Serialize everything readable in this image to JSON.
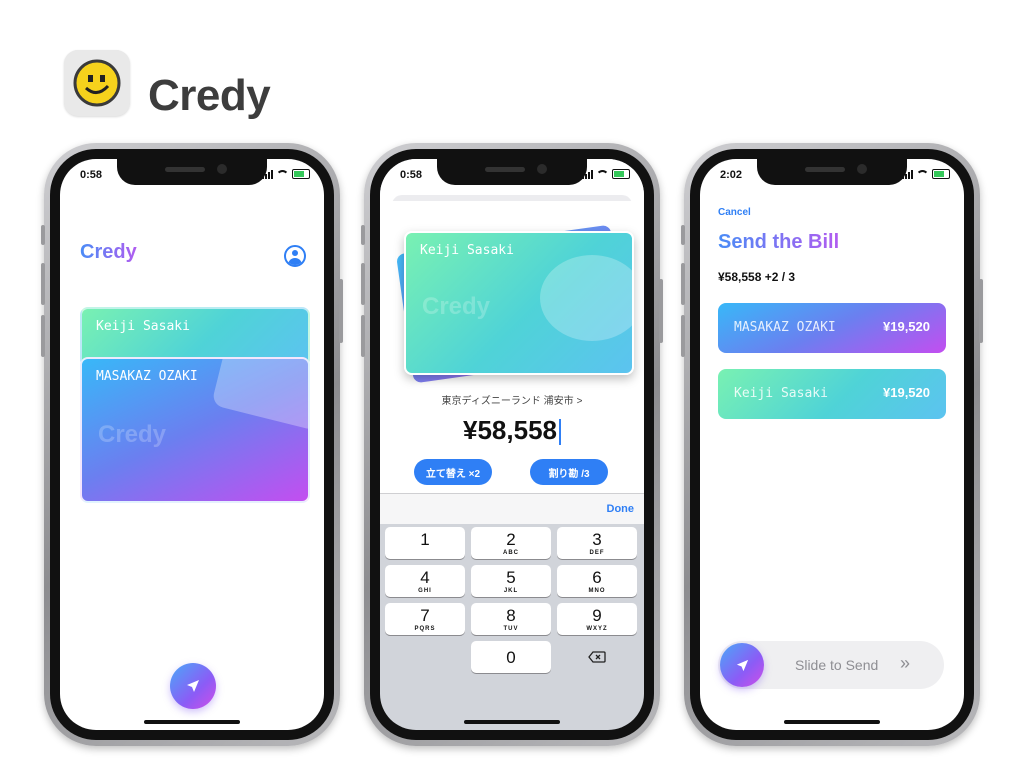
{
  "brand": {
    "title": "Credy"
  },
  "screen1": {
    "status_time": "0:58",
    "header_title": "Credy",
    "cards": [
      {
        "holder": "Keiji Sasaki"
      },
      {
        "holder": "MASAKAZ OZAKI",
        "watermark": "Credy"
      }
    ]
  },
  "screen2": {
    "status_time": "0:58",
    "card": {
      "holder": "Keiji Sasaki",
      "watermark": "Credy"
    },
    "location": "東京ディズニーランド 浦安市",
    "amount": "¥58,558",
    "buttons": {
      "advance": "立て替え ×2",
      "split": "割り勘 /3"
    },
    "done_label": "Done",
    "keypad": [
      {
        "num": "1",
        "letters": ""
      },
      {
        "num": "2",
        "letters": "ABC"
      },
      {
        "num": "3",
        "letters": "DEF"
      },
      {
        "num": "4",
        "letters": "GHI"
      },
      {
        "num": "5",
        "letters": "JKL"
      },
      {
        "num": "6",
        "letters": "MNO"
      },
      {
        "num": "7",
        "letters": "PQRS"
      },
      {
        "num": "8",
        "letters": "TUV"
      },
      {
        "num": "9",
        "letters": "WXYZ"
      },
      {
        "num": "0",
        "letters": ""
      }
    ]
  },
  "screen3": {
    "status_time": "2:02",
    "cancel_label": "Cancel",
    "title": "Send the Bill",
    "summary": "¥58,558 +2 / 3",
    "rows": [
      {
        "name": "MASAKAZ OZAKI",
        "amount": "¥19,520"
      },
      {
        "name": "Keiji Sasaki",
        "amount": "¥19,520"
      }
    ],
    "slide_label": "Slide to Send",
    "slide_chevron": "»"
  },
  "colors": {
    "accent_blue": "#2f7ff5",
    "title_gradient_start": "#4a8cf6",
    "title_gradient_end": "#b15cf0"
  }
}
